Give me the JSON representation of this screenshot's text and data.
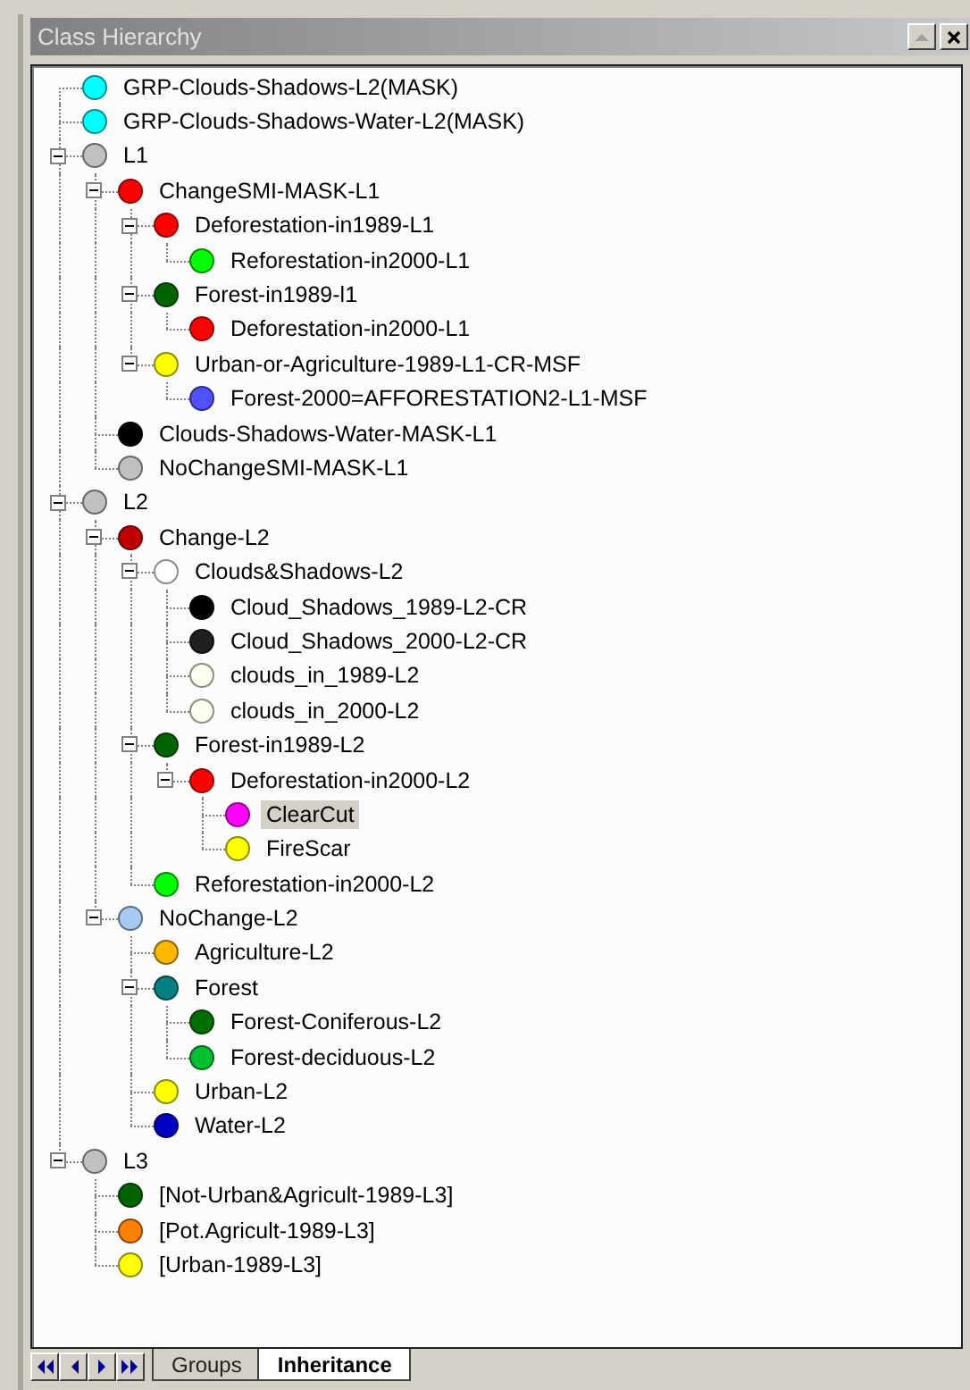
{
  "window": {
    "title": "Class Hierarchy"
  },
  "tree": {
    "items": [
      {
        "label": "GRP-Clouds-Shadows-L2(MASK)",
        "color": "#00ffff",
        "selected": false
      },
      {
        "label": "GRP-Clouds-Shadows-Water-L2(MASK)",
        "color": "#00ffff",
        "selected": false
      },
      {
        "label": "L1",
        "color": "#c0c0c0",
        "selected": false,
        "expanded": true,
        "children": [
          {
            "label": "ChangeSMI-MASK-L1",
            "color": "#ff0000",
            "selected": false,
            "expanded": true,
            "children": [
              {
                "label": "Deforestation-in1989-L1",
                "color": "#ff0000",
                "selected": false,
                "expanded": true,
                "children": [
                  {
                    "label": "Reforestation-in2000-L1",
                    "color": "#00ff00",
                    "selected": false
                  }
                ]
              },
              {
                "label": "Forest-in1989-l1",
                "color": "#006400",
                "selected": false,
                "expanded": true,
                "children": [
                  {
                    "label": "Deforestation-in2000-L1",
                    "color": "#ff0000",
                    "selected": false
                  }
                ]
              },
              {
                "label": "Urban-or-Agriculture-1989-L1-CR-MSF",
                "color": "#ffff00",
                "selected": false,
                "expanded": true,
                "children": [
                  {
                    "label": "Forest-2000=AFFORESTATION2-L1-MSF",
                    "color": "#5050ff",
                    "selected": false
                  }
                ]
              }
            ]
          },
          {
            "label": "Clouds-Shadows-Water-MASK-L1",
            "color": "#000000",
            "selected": false
          },
          {
            "label": "NoChangeSMI-MASK-L1",
            "color": "#c0c0c0",
            "selected": false
          }
        ]
      },
      {
        "label": "L2",
        "color": "#c0c0c0",
        "selected": false,
        "expanded": true,
        "children": [
          {
            "label": "Change-L2",
            "color": "#c00000",
            "selected": false,
            "expanded": true,
            "children": [
              {
                "label": "Clouds&Shadows-L2",
                "color": "#ffffff",
                "selected": false,
                "expanded": true,
                "children": [
                  {
                    "label": "Cloud_Shadows_1989-L2-CR",
                    "color": "#000000",
                    "selected": false
                  },
                  {
                    "label": "Cloud_Shadows_2000-L2-CR",
                    "color": "#202020",
                    "selected": false
                  },
                  {
                    "label": "clouds_in_1989-L2",
                    "color": "#fffff0",
                    "selected": false
                  },
                  {
                    "label": "clouds_in_2000-L2",
                    "color": "#fffff0",
                    "selected": false
                  }
                ]
              },
              {
                "label": "Forest-in1989-L2",
                "color": "#006400",
                "selected": false,
                "expanded": true,
                "children": [
                  {
                    "label": "Deforestation-in2000-L2",
                    "color": "#ff0000",
                    "selected": false,
                    "expanded": true,
                    "children": [
                      {
                        "label": "ClearCut",
                        "color": "#ff00ff",
                        "selected": true
                      },
                      {
                        "label": "FireScar",
                        "color": "#ffff00",
                        "selected": false
                      }
                    ]
                  }
                ]
              },
              {
                "label": "Reforestation-in2000-L2",
                "color": "#00ff00",
                "selected": false
              }
            ]
          },
          {
            "label": "NoChange-L2",
            "color": "#a6caf0",
            "selected": false,
            "expanded": true,
            "children": [
              {
                "label": "Agriculture-L2",
                "color": "#ffb800",
                "selected": false
              },
              {
                "label": "Forest",
                "color": "#008080",
                "selected": false,
                "expanded": true,
                "children": [
                  {
                    "label": "Forest-Coniferous-L2",
                    "color": "#007000",
                    "selected": false
                  },
                  {
                    "label": "Forest-deciduous-L2",
                    "color": "#00c030",
                    "selected": false
                  }
                ]
              },
              {
                "label": "Urban-L2",
                "color": "#ffff00",
                "selected": false
              },
              {
                "label": "Water-L2",
                "color": "#0000c0",
                "selected": false
              }
            ]
          }
        ]
      },
      {
        "label": "L3",
        "color": "#c0c0c0",
        "selected": false,
        "expanded": true,
        "children": [
          {
            "label": "[Not-Urban&Agricult-1989-L3]",
            "color": "#006400",
            "selected": false
          },
          {
            "label": "[Pot.Agricult-1989-L3]",
            "color": "#ff8000",
            "selected": false
          },
          {
            "label": "[Urban-1989-L3]",
            "color": "#ffff00",
            "selected": false
          }
        ]
      }
    ]
  },
  "tabs": [
    {
      "label": "Groups",
      "selected": false
    },
    {
      "label": "Inheritance",
      "selected": true
    }
  ]
}
